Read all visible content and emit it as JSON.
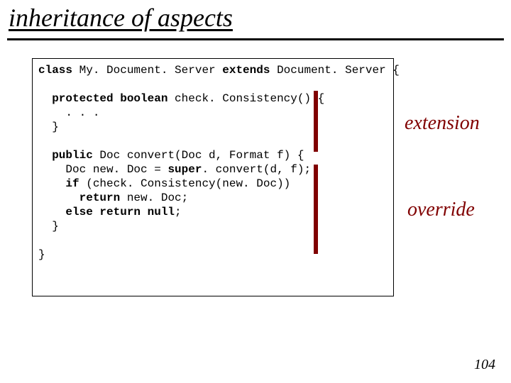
{
  "title": "inheritance of aspects",
  "code": {
    "l1a": "class",
    "l1b": " My. Document. Server ",
    "l1c": "extends",
    "l1d": " Document. Server {",
    "l2": "",
    "l3a": "  protected boolean",
    "l3b": " check. Consistency() {",
    "l4": "    . . .",
    "l5": "  }",
    "l6": "",
    "l7a": "  public ",
    "l7b": "Doc convert(Doc d, Format f) {",
    "l8a": "    Doc new. Doc = ",
    "l8b": "super",
    "l8c": ". convert(d, f);",
    "l9a": "    if ",
    "l9b": "(check. Consistency(new. Doc))",
    "l10a": "      return ",
    "l10b": "new. Doc;",
    "l11a": "    else return null",
    "l11b": ";",
    "l12": "  }",
    "l13": "",
    "l14": "}"
  },
  "labels": {
    "extension": "extension",
    "override": "override"
  },
  "page": "104"
}
